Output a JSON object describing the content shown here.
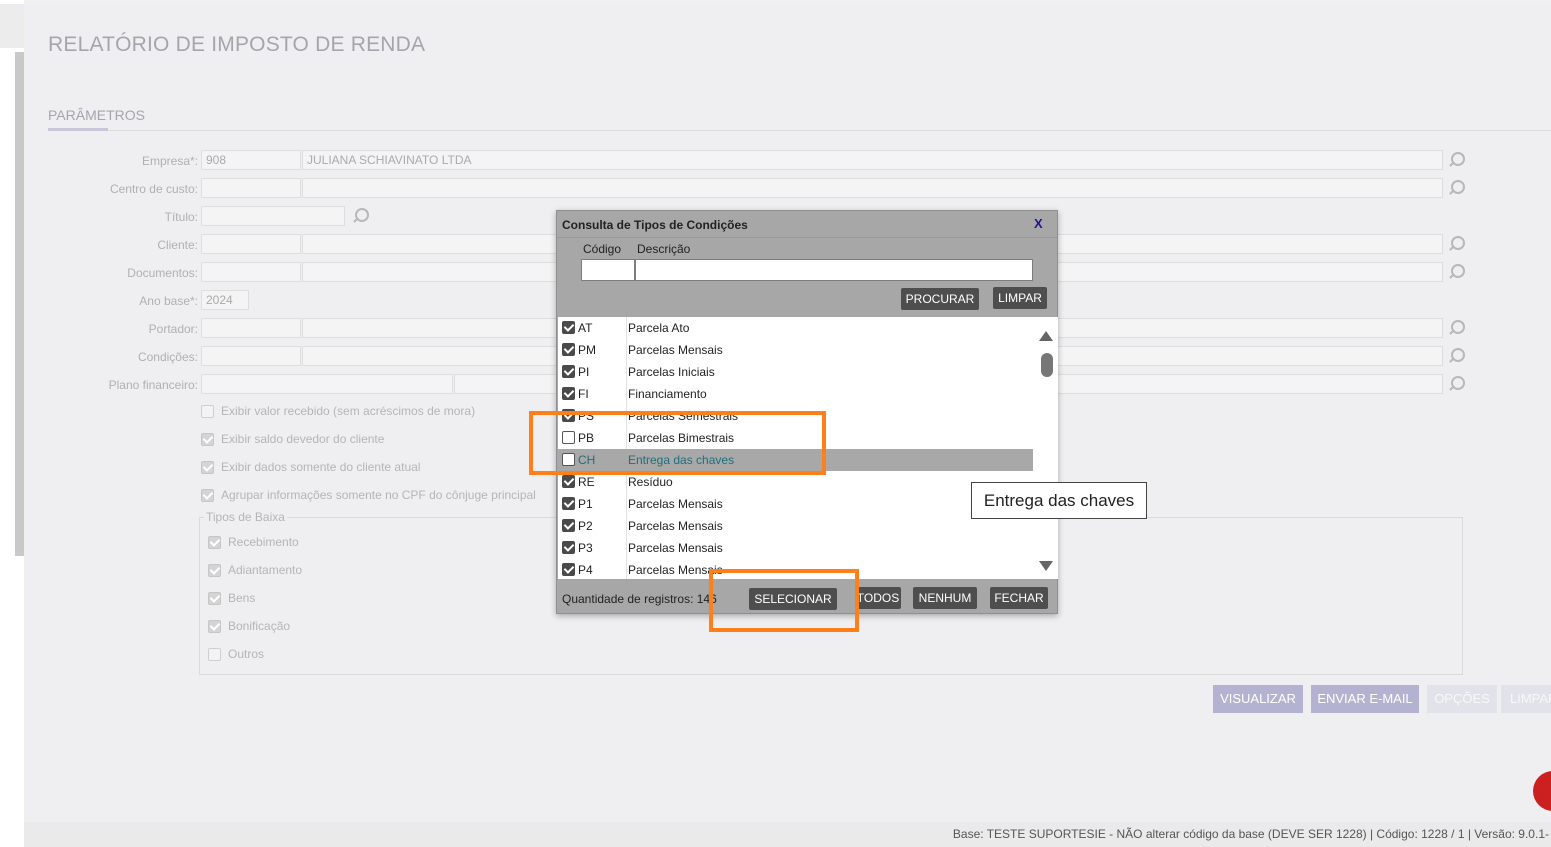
{
  "page": {
    "title": "RELATÓRIO DE IMPOSTO DE RENDA",
    "section_title": "PARÂMETROS"
  },
  "form": {
    "empresa": {
      "label": "Empresa*:",
      "code": "908",
      "name": "JULIANA SCHIAVINATO LTDA"
    },
    "centro_custo": {
      "label": "Centro de custo:"
    },
    "titulo": {
      "label": "Título:"
    },
    "cliente": {
      "label": "Cliente:"
    },
    "documentos": {
      "label": "Documentos:"
    },
    "ano_base": {
      "label": "Ano base*:",
      "value": "2024"
    },
    "portador": {
      "label": "Portador:"
    },
    "condicoes": {
      "label": "Condições:"
    },
    "plano_financeiro": {
      "label": "Plano financeiro:"
    },
    "options": [
      {
        "label": "Exibir valor recebido (sem acréscimos de mora)",
        "checked": false
      },
      {
        "label": "Exibir saldo devedor do cliente",
        "checked": true
      },
      {
        "label": "Exibir dados somente do cliente atual",
        "checked": true
      },
      {
        "label": "Agrupar informações somente no CPF do cônjuge principal",
        "checked": true
      }
    ],
    "tipos_baixa": {
      "legend": "Tipos de Baixa",
      "items": [
        {
          "label": "Recebimento",
          "checked": true
        },
        {
          "label": "Adiantamento",
          "checked": true
        },
        {
          "label": "Bens",
          "checked": true
        },
        {
          "label": "Bonificação",
          "checked": true
        },
        {
          "label": "Outros",
          "checked": false
        }
      ]
    }
  },
  "actions": {
    "visualizar": "VISUALIZAR",
    "enviar_email": "ENVIAR E-MAIL",
    "opcoes": "OPÇÕES",
    "limpar": "LIMPAR"
  },
  "footer": {
    "text": "Base: TESTE SUPORTESIE - NÃO alterar código da base (DEVE SER 1228) | Código: 1228 / 1 | Versão: 9.0.1-"
  },
  "modal": {
    "title": "Consulta de Tipos de Condições",
    "close": "X",
    "col_code": "Código",
    "col_desc": "Descrição",
    "btn_procurar": "PROCURAR",
    "btn_limpar": "LIMPAR",
    "rows": [
      {
        "code": "AT",
        "desc": "Parcela Ato",
        "checked": true
      },
      {
        "code": "PM",
        "desc": "Parcelas Mensais",
        "checked": true
      },
      {
        "code": "PI",
        "desc": "Parcelas Iniciais",
        "checked": true
      },
      {
        "code": "FI",
        "desc": "Financiamento",
        "checked": true
      },
      {
        "code": "PS",
        "desc": "Parcelas Semestrais",
        "checked": true
      },
      {
        "code": "PB",
        "desc": "Parcelas Bimestrais",
        "checked": false
      },
      {
        "code": "CH",
        "desc": "Entrega das chaves",
        "checked": false,
        "selected": true
      },
      {
        "code": "RE",
        "desc": "Resíduo",
        "checked": true
      },
      {
        "code": "P1",
        "desc": "Parcelas Mensais",
        "checked": true
      },
      {
        "code": "P2",
        "desc": "Parcelas Mensais",
        "checked": true
      },
      {
        "code": "P3",
        "desc": "Parcelas Mensais",
        "checked": true
      },
      {
        "code": "P4",
        "desc": "Parcelas Mensais",
        "checked": true
      }
    ],
    "count_text": "Quantidade de registros: 146",
    "btn_selecionar": "SELECIONAR",
    "btn_todos": "TODOS",
    "btn_nenhum": "NENHUM",
    "btn_fechar": "FECHAR",
    "tooltip": "Entrega das chaves"
  },
  "colors": {
    "accent": "#c7c6db",
    "highlight": "#ff7f1a",
    "action_button": "#b4b2d1",
    "modal_button": "#4e4e4e"
  }
}
